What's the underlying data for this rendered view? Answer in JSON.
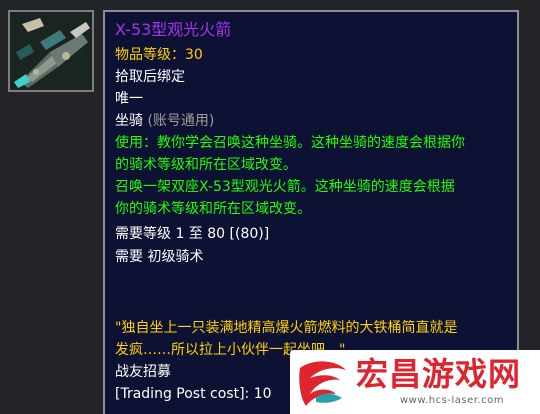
{
  "item": {
    "name": "X-53型观光火箭",
    "item_level_label": "物品等级：",
    "item_level_value": "30",
    "bind": "拾取后绑定",
    "unique": "唯一",
    "type_label": "坐骑",
    "type_note": "(账号通用)",
    "use_lines": [
      "使用：教你学会召唤这种坐骑。这种坐骑的速度会根据你",
      "的骑术等级和所在区域改变。",
      "召唤一架双座X-53型观光火箭。这种坐骑的速度会根据",
      "你的骑术等级和所在区域改变。"
    ],
    "req_level": "需要等级 1 至 80 [(80)]",
    "req_skill": "需要 初级骑术",
    "flavor_lines": [
      "\"独自坐上一只装满地精高爆火箭燃料的大铁桶简直就是",
      "发疯……所以拉上小伙伴一起坐吧。\""
    ],
    "source": "战友招募",
    "trading_post": "[Trading Post cost]:  10"
  },
  "colors": {
    "epic": "#a335ee",
    "quest_yellow": "#ffd100",
    "use_green": "#1eff00",
    "tooltip_bg": "#0d1133"
  },
  "watermark": {
    "title": "宏昌游戏网",
    "url": "www.hcs-laser.com"
  },
  "icon": {
    "name": "rocket-mount-icon"
  }
}
